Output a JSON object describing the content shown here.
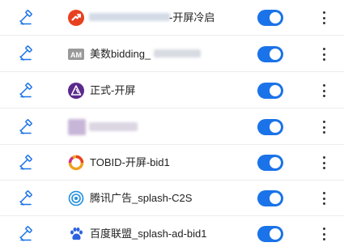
{
  "colors": {
    "accent": "#1a73e8",
    "icon_blue": "#1a73e8",
    "divider": "#ececec"
  },
  "rows": [
    {
      "name": "-开屏冷启",
      "logo": "red-circle-arrow-logo",
      "enabled": true
    },
    {
      "name": "美数bidding_",
      "logo": "am-logo",
      "enabled": true
    },
    {
      "name": "正式-开屏",
      "logo": "purple-triangle-logo",
      "enabled": true
    },
    {
      "name": "",
      "logo": "",
      "enabled": true
    },
    {
      "name": "TOBID-开屏-bid1",
      "logo": "tobid-ring-logo",
      "enabled": true
    },
    {
      "name": "腾讯广告_splash-C2S",
      "logo": "tencent-ads-logo",
      "enabled": true
    },
    {
      "name": "百度联盟_splash-ad-bid1",
      "logo": "baidu-paw-logo",
      "enabled": true
    }
  ]
}
